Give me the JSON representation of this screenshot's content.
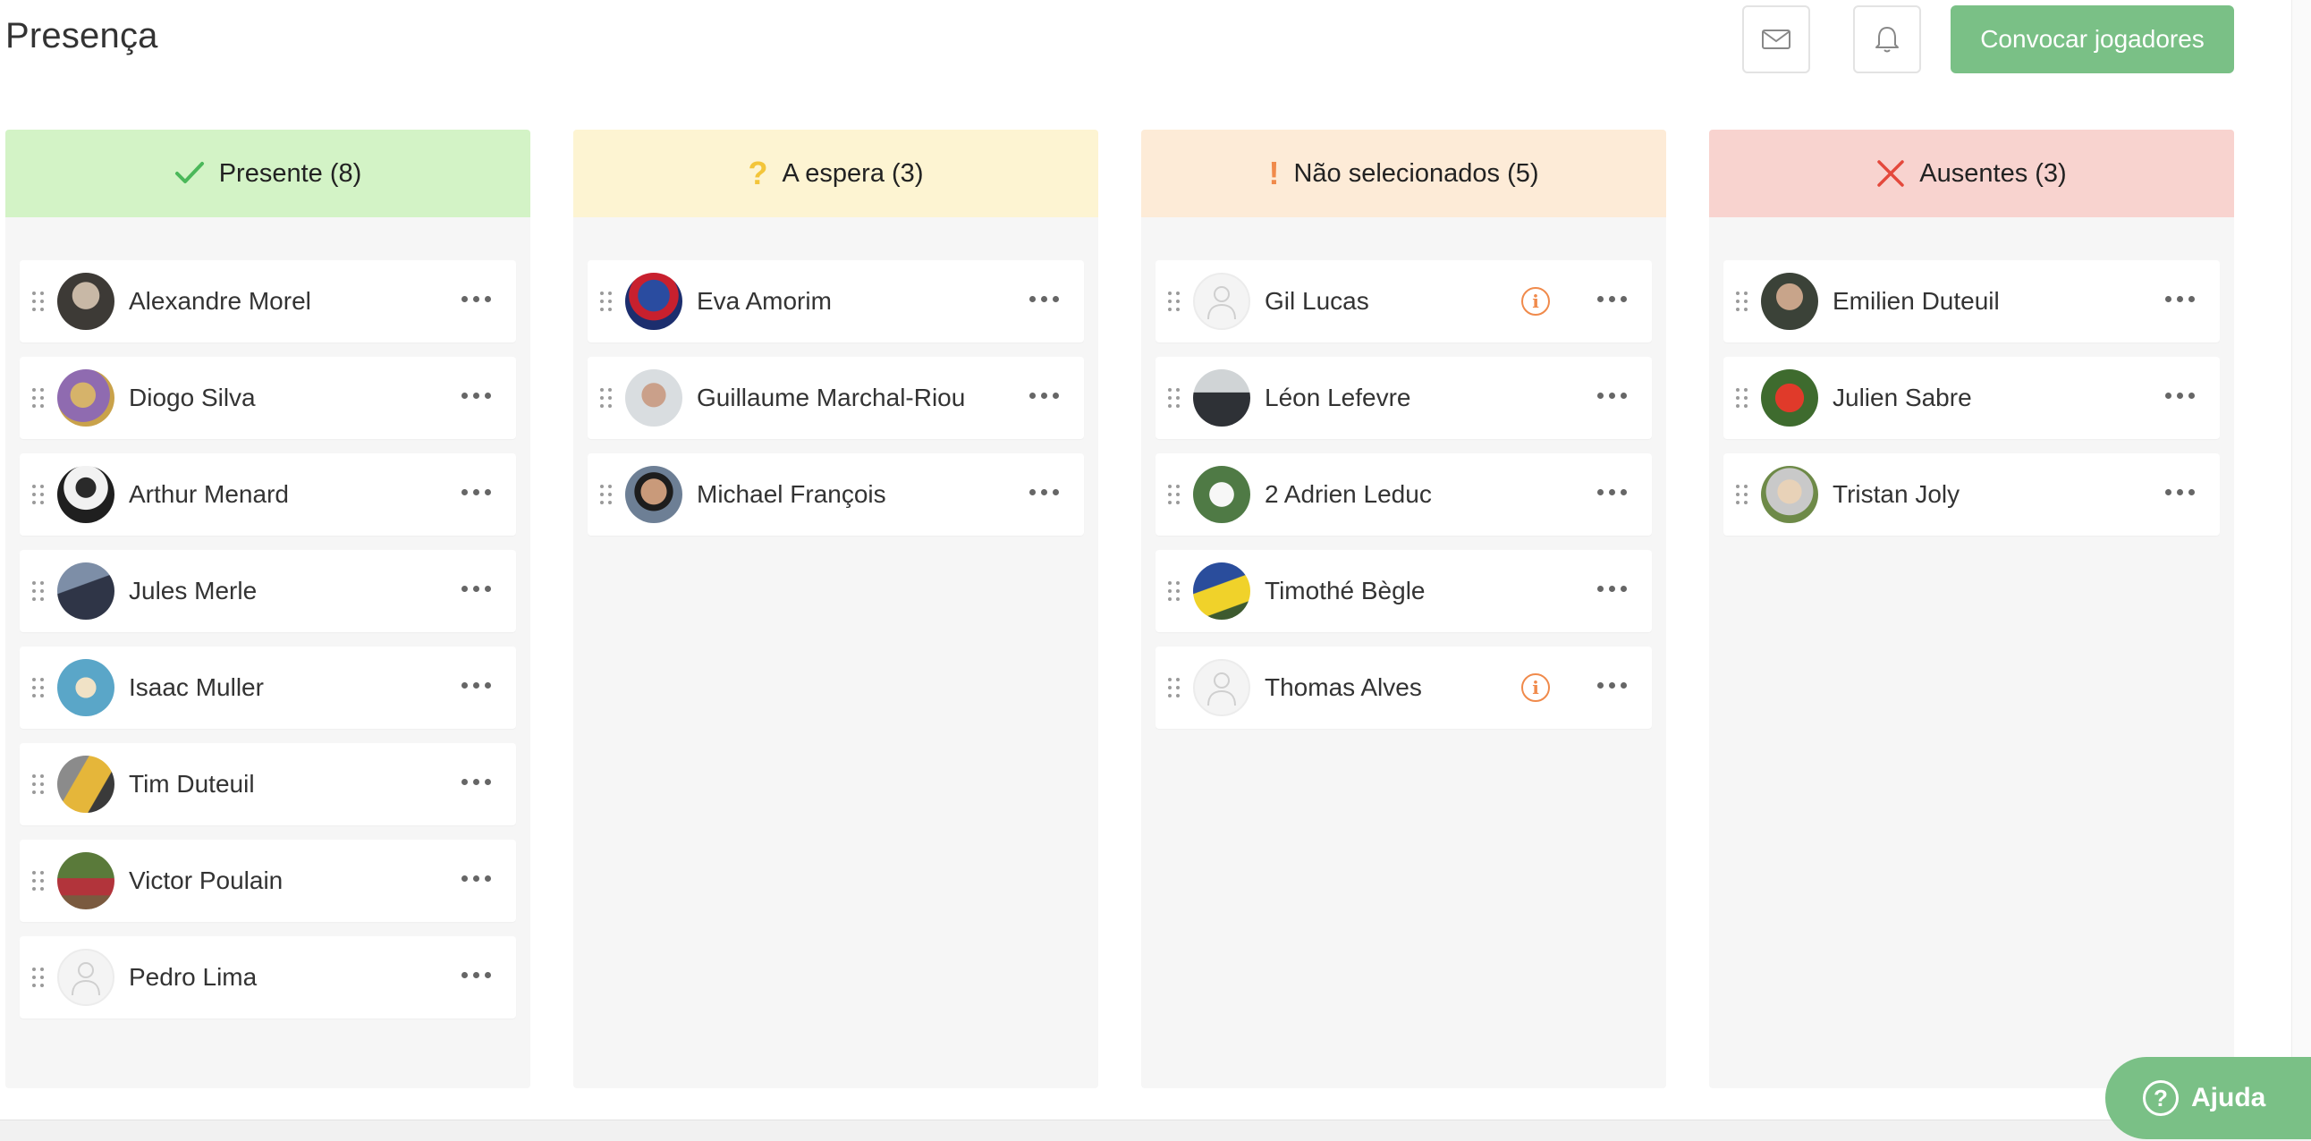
{
  "header": {
    "title": "Presença",
    "call_button": "Convocar jogadores"
  },
  "columns": [
    {
      "title": "Presente (8)",
      "icon": "check-icon",
      "color": "#d3f3c6",
      "players": [
        {
          "name": "Alexandre Morel"
        },
        {
          "name": "Diogo Silva"
        },
        {
          "name": "Arthur Menard"
        },
        {
          "name": "Jules Merle"
        },
        {
          "name": "Isaac Muller"
        },
        {
          "name": "Tim Duteuil"
        },
        {
          "name": "Victor Poulain"
        },
        {
          "name": "Pedro Lima"
        }
      ]
    },
    {
      "title": "A espera (3)",
      "icon": "question-icon",
      "color": "#fdf4d2",
      "players": [
        {
          "name": "Eva Amorim"
        },
        {
          "name": "Guillaume Marchal-Riou"
        },
        {
          "name": "Michael François"
        }
      ]
    },
    {
      "title": "Não selecionados (5)",
      "icon": "exclamation-icon",
      "color": "#fdebd7",
      "players": [
        {
          "name": "Gil Lucas",
          "info": "i"
        },
        {
          "name": "Léon Lefevre"
        },
        {
          "name": "2 Adrien Leduc"
        },
        {
          "name": "Timothé Bègle"
        },
        {
          "name": "Thomas Alves",
          "info": "i"
        }
      ]
    },
    {
      "title": "Ausentes (3)",
      "icon": "cross-icon",
      "color": "#f8d3cf",
      "players": [
        {
          "name": "Emilien Duteuil"
        },
        {
          "name": "Julien Sabre"
        },
        {
          "name": "Tristan Joly"
        }
      ]
    }
  ],
  "help": {
    "symbol": "?",
    "label": "Ajuda"
  },
  "colors": {
    "accent_green": "#7ac086",
    "check_green": "#4bb85a",
    "question_yellow": "#f3c53a",
    "exclamation_orange": "#f08a4b",
    "cross_red": "#e4493c"
  }
}
